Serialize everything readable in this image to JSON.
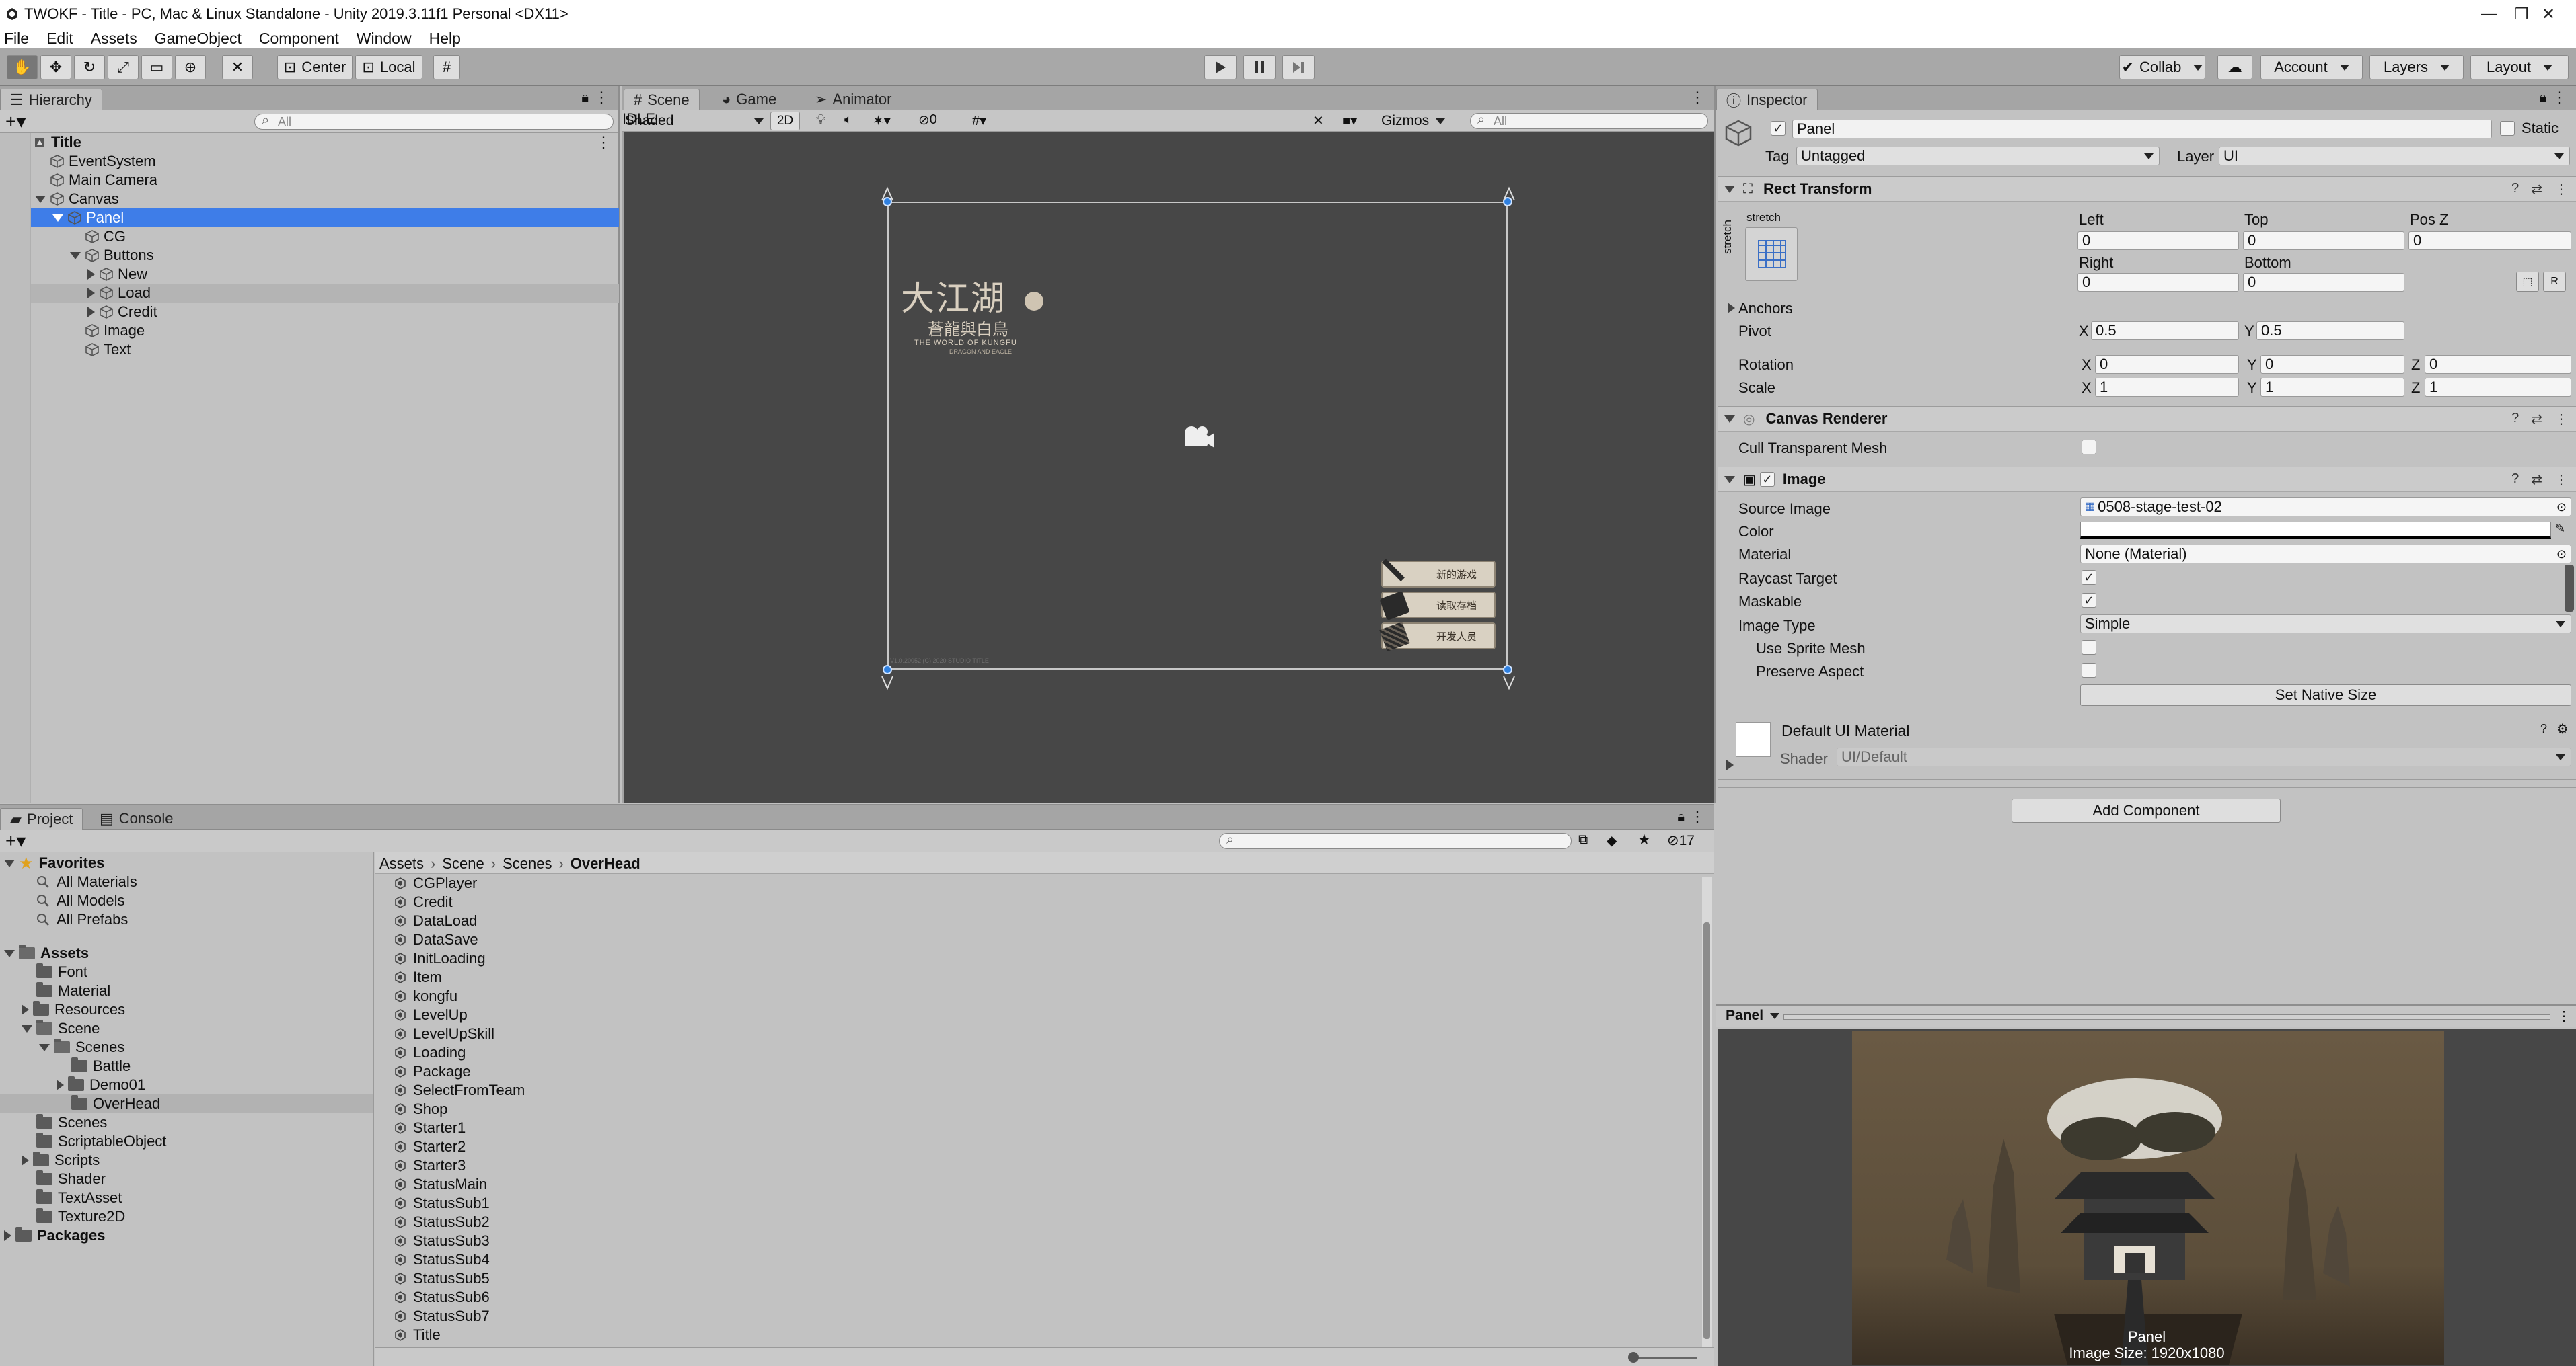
{
  "window": {
    "title": "TWOKF - Title - PC, Mac & Linux Standalone - Unity 2019.3.11f1 Personal <DX11>"
  },
  "menu": [
    "File",
    "Edit",
    "Assets",
    "GameObject",
    "Component",
    "Window",
    "Help"
  ],
  "toolbar": {
    "pivot": "Center",
    "space": "Local",
    "collab": "Collab",
    "account": "Account",
    "layers": "Layers",
    "layout": "Layout"
  },
  "hierarchy": {
    "tab": "Hierarchy",
    "search_placeholder": "All",
    "rows": [
      {
        "label": "Title",
        "depth": 1,
        "fold": "open",
        "bold": true,
        "icon": "scene"
      },
      {
        "label": "EventSystem",
        "depth": 2,
        "fold": "none"
      },
      {
        "label": "Main Camera",
        "depth": 2,
        "fold": "none"
      },
      {
        "label": "Canvas",
        "depth": 2,
        "fold": "open"
      },
      {
        "label": "Panel",
        "depth": 3,
        "fold": "open",
        "selected": true
      },
      {
        "label": "CG",
        "depth": 4,
        "fold": "none"
      },
      {
        "label": "Buttons",
        "depth": 4,
        "fold": "open"
      },
      {
        "label": "New",
        "depth": 5,
        "fold": "closed"
      },
      {
        "label": "Load",
        "depth": 5,
        "fold": "closed",
        "hover": true
      },
      {
        "label": "Credit",
        "depth": 5,
        "fold": "closed"
      },
      {
        "label": "Image",
        "depth": 4,
        "fold": "none"
      },
      {
        "label": "Text",
        "depth": 4,
        "fold": "none"
      }
    ]
  },
  "scene": {
    "tabs": [
      "Scene",
      "Game",
      "Animator"
    ],
    "shading": "Shaded",
    "mode2d": "2D",
    "hidden_count": "0",
    "gizmos": "Gizmos",
    "search_placeholder": "All",
    "logo_main": "大江湖",
    "logo_sub": "蒼龍與白鳥",
    "logo_en": "THE WORLD OF KUNGFU",
    "logo_en2": "DRAGON AND EAGLE",
    "buttons": [
      "新的游戏",
      "读取存档",
      "开发人员"
    ],
    "footer": "V1.0.20052 (C) 2020 STUDIO TITLE"
  },
  "inspector": {
    "tab": "Inspector",
    "object_name": "Panel",
    "static_label": "Static",
    "tag_label": "Tag",
    "tag": "Untagged",
    "layer_label": "Layer",
    "layer": "UI",
    "rect": {
      "title": "Rect Transform",
      "anchor_preset": "stretch",
      "anchor_side": "stretch",
      "left_label": "Left",
      "left": "0",
      "top_label": "Top",
      "top": "0",
      "posz_label": "Pos Z",
      "posz": "0",
      "right_label": "Right",
      "right": "0",
      "bottom_label": "Bottom",
      "bottom": "0",
      "anchors_label": "Anchors",
      "pivot_label": "Pivot",
      "pivot_x": "0.5",
      "pivot_y": "0.5",
      "rotation_label": "Rotation",
      "rot_x": "0",
      "rot_y": "0",
      "rot_z": "0",
      "scale_label": "Scale",
      "scale_x": "1",
      "scale_y": "1",
      "scale_z": "1",
      "x": "X",
      "y": "Y",
      "z": "Z",
      "r_button": "R"
    },
    "canvas_renderer": {
      "title": "Canvas Renderer",
      "cull_label": "Cull Transparent Mesh"
    },
    "image": {
      "title": "Image",
      "source_label": "Source Image",
      "source": "0508-stage-test-02",
      "color_label": "Color",
      "material_label": "Material",
      "material": "None (Material)",
      "raycast_label": "Raycast Target",
      "maskable_label": "Maskable",
      "type_label": "Image Type",
      "type": "Simple",
      "sprite_mesh_label": "Use Sprite Mesh",
      "preserve_label": "Preserve Aspect",
      "native_button": "Set Native Size"
    },
    "material": {
      "title": "Default UI Material",
      "shader_label": "Shader",
      "shader": "UI/Default"
    },
    "add_component": "Add Component",
    "preview": {
      "dropdown": "Panel",
      "caption": "Panel",
      "size": "Image Size: 1920x1080"
    }
  },
  "project": {
    "tabs": [
      "Project",
      "Console"
    ],
    "hidden_count": "17",
    "tree": [
      {
        "label": "Favorites",
        "kind": "fav",
        "depth": 0,
        "fold": "open",
        "bold": true
      },
      {
        "label": "All Materials",
        "kind": "search",
        "depth": 1
      },
      {
        "label": "All Models",
        "kind": "search",
        "depth": 1
      },
      {
        "label": "All Prefabs",
        "kind": "search",
        "depth": 1
      },
      {
        "label": "",
        "kind": "gap"
      },
      {
        "label": "Assets",
        "kind": "folder",
        "depth": 0,
        "fold": "open",
        "bold": true
      },
      {
        "label": "Font",
        "kind": "folder",
        "depth": 1
      },
      {
        "label": "Material",
        "kind": "folder",
        "depth": 1
      },
      {
        "label": "Resources",
        "kind": "folder",
        "depth": 1,
        "fold": "closed"
      },
      {
        "label": "Scene",
        "kind": "folder",
        "depth": 1,
        "fold": "open"
      },
      {
        "label": "Scenes",
        "kind": "folder",
        "depth": 2,
        "fold": "open"
      },
      {
        "label": "Battle",
        "kind": "folder",
        "depth": 3
      },
      {
        "label": "Demo01",
        "kind": "folder",
        "depth": 3,
        "fold": "closed"
      },
      {
        "label": "OverHead",
        "kind": "folder",
        "depth": 3,
        "selected": true
      },
      {
        "label": "Scenes",
        "kind": "folder",
        "depth": 1
      },
      {
        "label": "ScriptableObject",
        "kind": "folder",
        "depth": 1
      },
      {
        "label": "Scripts",
        "kind": "folder",
        "depth": 1,
        "fold": "closed"
      },
      {
        "label": "Shader",
        "kind": "folder",
        "depth": 1
      },
      {
        "label": "TextAsset",
        "kind": "folder",
        "depth": 1
      },
      {
        "label": "Texture2D",
        "kind": "folder",
        "depth": 1
      },
      {
        "label": "Packages",
        "kind": "folder",
        "depth": 0,
        "fold": "closed",
        "bold": true
      }
    ],
    "breadcrumb": [
      "Assets",
      "Scene",
      "Scenes",
      "OverHead"
    ],
    "assets": [
      "CGPlayer",
      "Credit",
      "DataLoad",
      "DataSave",
      "InitLoading",
      "Item",
      "kongfu",
      "LevelUp",
      "LevelUpSkill",
      "Loading",
      "Package",
      "SelectFromTeam",
      "Shop",
      "Starter1",
      "Starter2",
      "Starter3",
      "StatusMain",
      "StatusSub1",
      "StatusSub2",
      "StatusSub3",
      "StatusSub4",
      "StatusSub5",
      "StatusSub6",
      "StatusSub7",
      "Title"
    ]
  }
}
